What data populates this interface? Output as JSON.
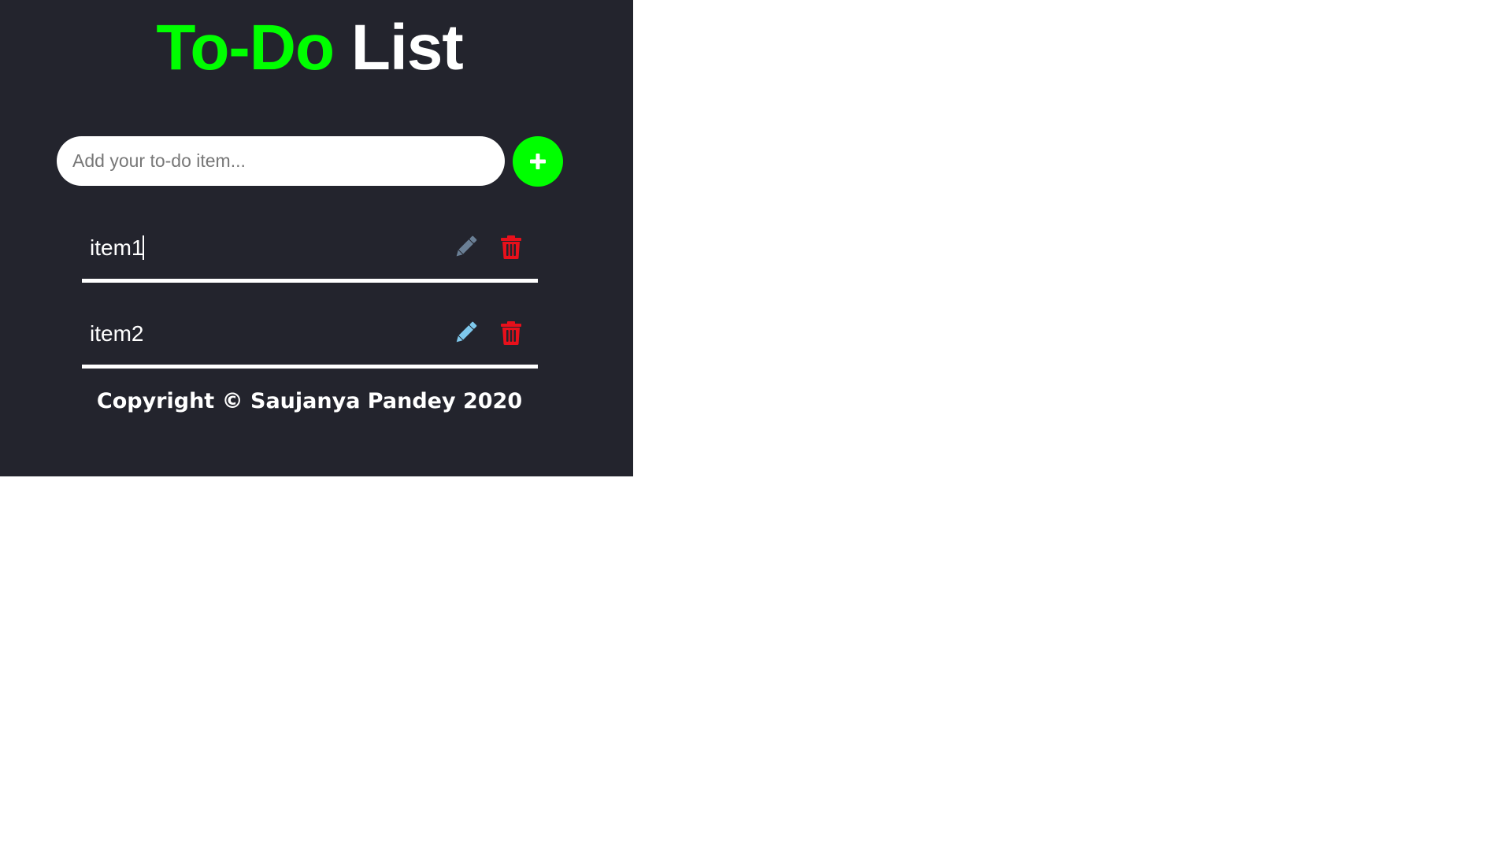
{
  "header": {
    "title_accent": "To-Do",
    "title_rest": "List"
  },
  "input": {
    "placeholder": "Add your to-do item...",
    "value": ""
  },
  "add_button": {
    "icon": "plus-icon"
  },
  "todos": [
    {
      "text": "item1",
      "edit_icon": "pencil-icon",
      "delete_icon": "trash-icon",
      "focused": true
    },
    {
      "text": "item2",
      "edit_icon": "pencil-icon",
      "delete_icon": "trash-icon",
      "focused": false
    }
  ],
  "footer": {
    "copyright": "Copyright © Saujanya Pandey 2020"
  },
  "colors": {
    "background": "#23242d",
    "accent": "#00ff00",
    "text": "#ffffff",
    "delete": "#e8101b",
    "edit_focused": "#6a7f95",
    "edit": "#7ec8ec"
  }
}
